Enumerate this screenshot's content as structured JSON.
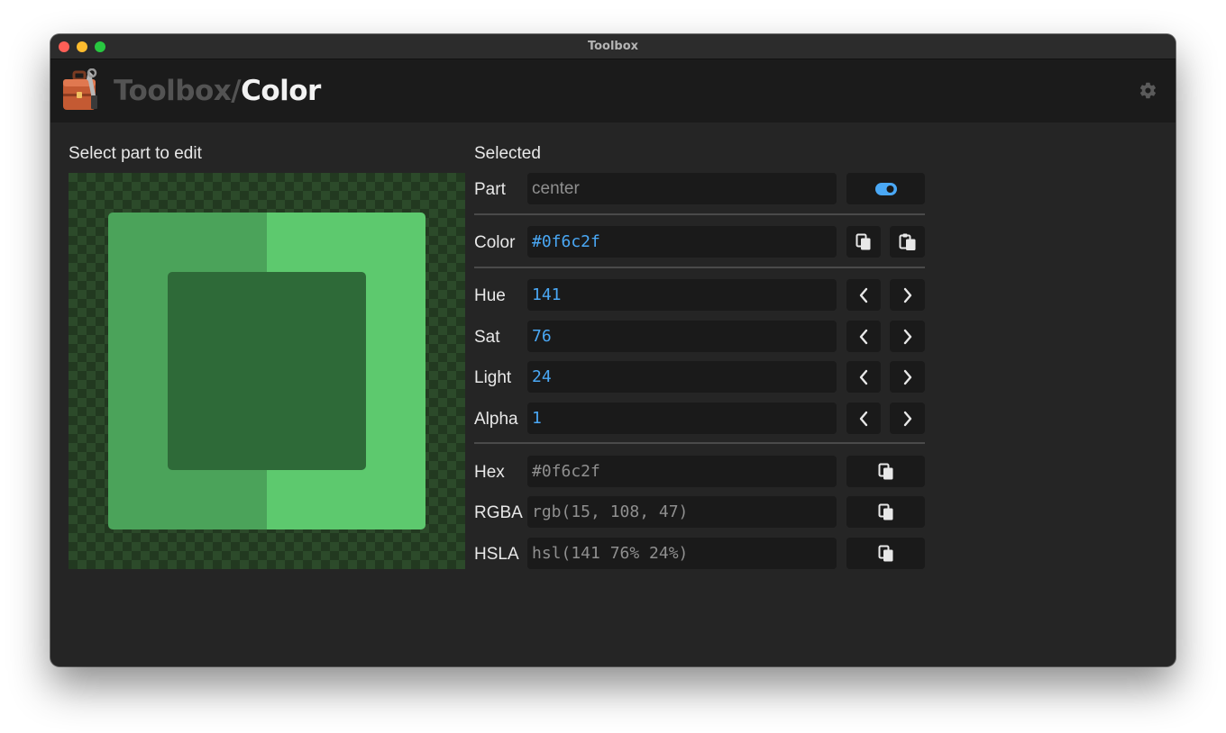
{
  "window": {
    "title": "Toolbox"
  },
  "header": {
    "app_name": "Toolbox/",
    "tool_name": "Color"
  },
  "left": {
    "label": "Select part to edit"
  },
  "canvas": {
    "colors": {
      "left": "#4ba35a",
      "right": "#5dc96e",
      "center": "#2e6a38"
    }
  },
  "selected": {
    "title": "Selected",
    "part": {
      "label": "Part",
      "value": "center"
    },
    "color": {
      "label": "Color",
      "value": "#0f6c2f"
    },
    "hue": {
      "label": "Hue",
      "value": "141"
    },
    "sat": {
      "label": "Sat",
      "value": "76"
    },
    "light": {
      "label": "Light",
      "value": "24"
    },
    "alpha": {
      "label": "Alpha",
      "value": "1"
    },
    "hex": {
      "label": "Hex",
      "value": "#0f6c2f"
    },
    "rgba": {
      "label": "RGBA",
      "value": "rgb(15, 108, 47)"
    },
    "hsla": {
      "label": "HSLA",
      "value": "hsl(141 76% 24%)"
    }
  },
  "colors": {
    "accent": "#4aa8f5",
    "background": "#252525",
    "header": "#1b1b1b",
    "field": "#1a1a1a"
  },
  "icons": {
    "logo": "toolbox-logo-icon",
    "settings": "gear-icon",
    "toggle": "toggle-icon",
    "copy": "copy-icon",
    "paste": "paste-icon",
    "prev": "chevron-left-icon",
    "next": "chevron-right-icon"
  }
}
